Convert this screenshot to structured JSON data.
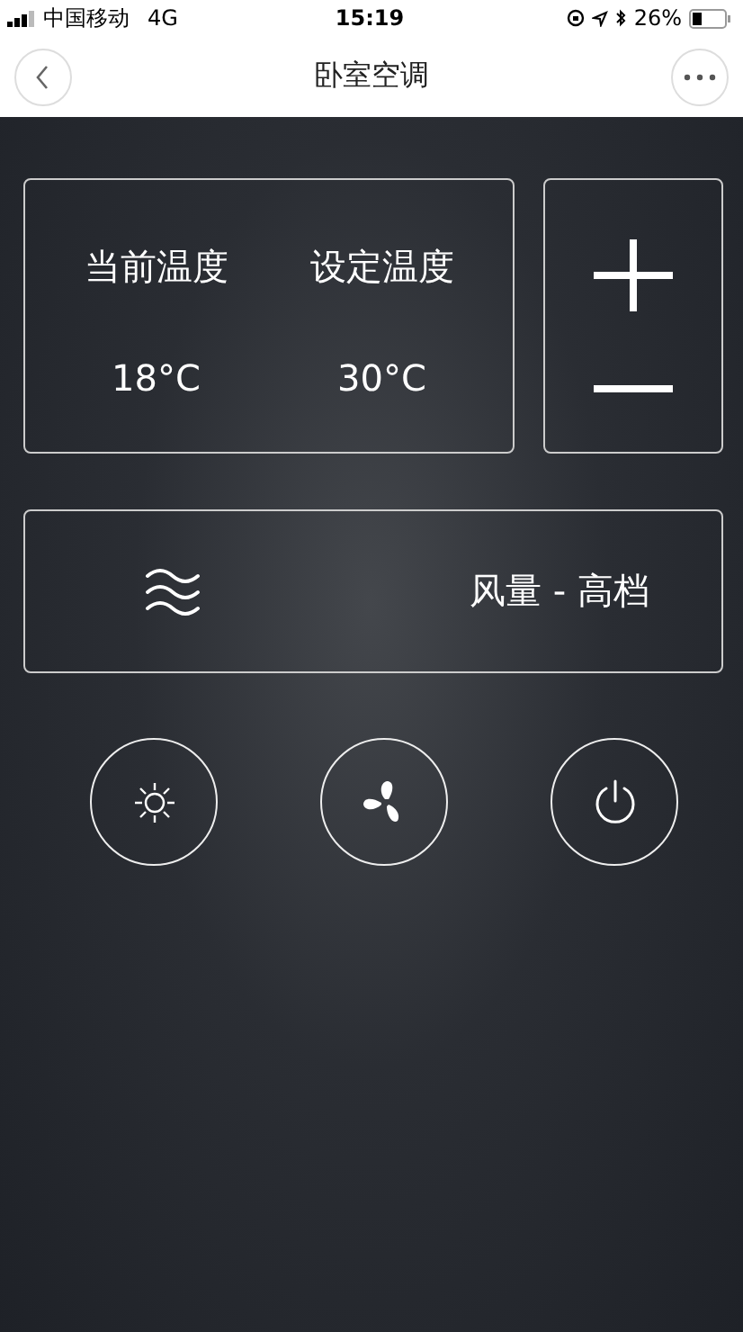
{
  "status_bar": {
    "carrier": "中国移动",
    "network": "4G",
    "time": "15:19",
    "battery_percent": "26%"
  },
  "nav": {
    "title": "卧室空调"
  },
  "temperature": {
    "current_label": "当前温度",
    "set_label": "设定温度",
    "current_value": "18°C",
    "set_value": "30°C"
  },
  "fan_speed": {
    "label": "风量 - 高档"
  },
  "mode_buttons": [
    {
      "kind": "sun"
    },
    {
      "kind": "fan"
    },
    {
      "kind": "power"
    }
  ]
}
